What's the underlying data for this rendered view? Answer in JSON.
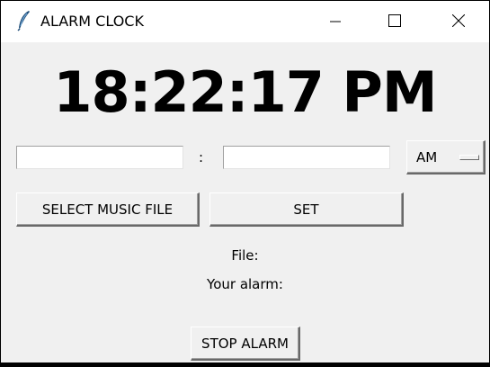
{
  "window": {
    "title": "ALARM CLOCK",
    "icons": {
      "app": "feather-icon",
      "minimize": "minimize-icon",
      "maximize": "maximize-icon",
      "close": "close-icon"
    }
  },
  "clock": {
    "time": "18:22:17 PM"
  },
  "alarm_inputs": {
    "hour_value": "",
    "minute_value": "",
    "separator": ":",
    "period_selected": "AM"
  },
  "buttons": {
    "select_music": "SELECT MUSIC FILE",
    "set": "SET",
    "stop_alarm": "STOP ALARM"
  },
  "info": {
    "file_label": "File:",
    "alarm_label": "Your alarm:"
  }
}
